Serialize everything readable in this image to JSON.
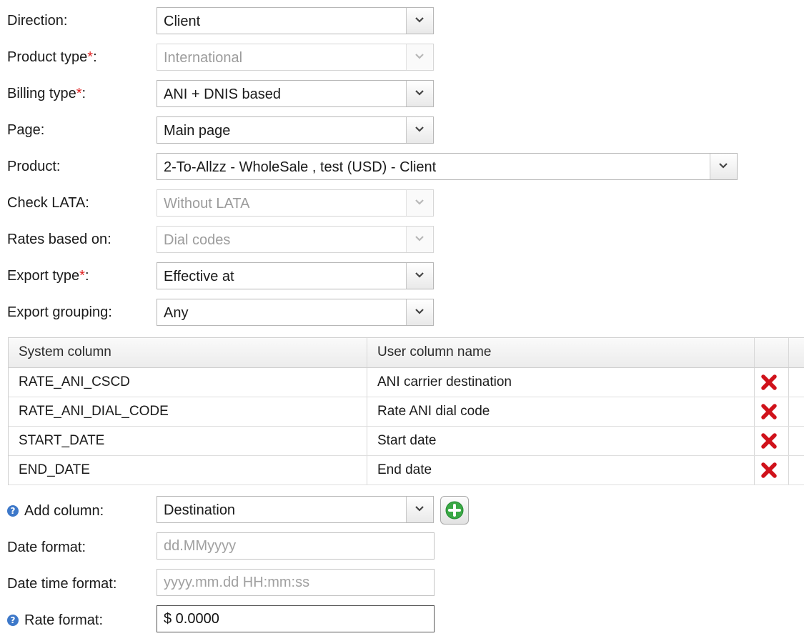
{
  "form": {
    "direction": {
      "label": "Direction:",
      "value": "Client"
    },
    "product_type": {
      "label": "Product type",
      "required_mark": "*",
      "suffix": ":",
      "value": "International"
    },
    "billing_type": {
      "label": "Billing type",
      "required_mark": "*",
      "suffix": ":",
      "value": "ANI + DNIS based"
    },
    "page": {
      "label": "Page:",
      "value": "Main page"
    },
    "product": {
      "label": "Product:",
      "value": "2-To-Allzz - WholeSale , test (USD) - Client"
    },
    "check_lata": {
      "label": "Check LATA:",
      "value": "Without LATA"
    },
    "rates_based_on": {
      "label": "Rates based on:",
      "value": "Dial codes"
    },
    "export_type": {
      "label": "Export type",
      "required_mark": "*",
      "suffix": ":",
      "value": "Effective at"
    },
    "export_grouping": {
      "label": "Export grouping:",
      "value": "Any"
    }
  },
  "grid": {
    "headers": {
      "system_column": "System column",
      "user_column_name": "User column name"
    },
    "rows": [
      {
        "system": "RATE_ANI_CSCD",
        "user": "ANI carrier destination"
      },
      {
        "system": "RATE_ANI_DIAL_CODE",
        "user": "Rate ANI dial code"
      },
      {
        "system": "START_DATE",
        "user": "Start date"
      },
      {
        "system": "END_DATE",
        "user": "End date"
      }
    ]
  },
  "add_column": {
    "label": "Add column:",
    "help": "?",
    "value": "Destination"
  },
  "date_format": {
    "label": "Date format:",
    "placeholder": "dd.MMyyyy"
  },
  "date_time_format": {
    "label": "Date time format:",
    "placeholder": "yyyy.mm.dd HH:mm:ss"
  },
  "rate_format": {
    "label": "Rate format:",
    "help": "?",
    "value": "$ 0.0000"
  },
  "colors": {
    "required": "#e02020",
    "delete_icon": "#d0121b",
    "add_icon": "#3aa845",
    "help_icon": "#3d78c9"
  },
  "icons": {
    "dropdown": "chevron-down-icon",
    "delete": "delete-x-icon",
    "add": "plus-circle-icon",
    "help": "help-icon"
  }
}
